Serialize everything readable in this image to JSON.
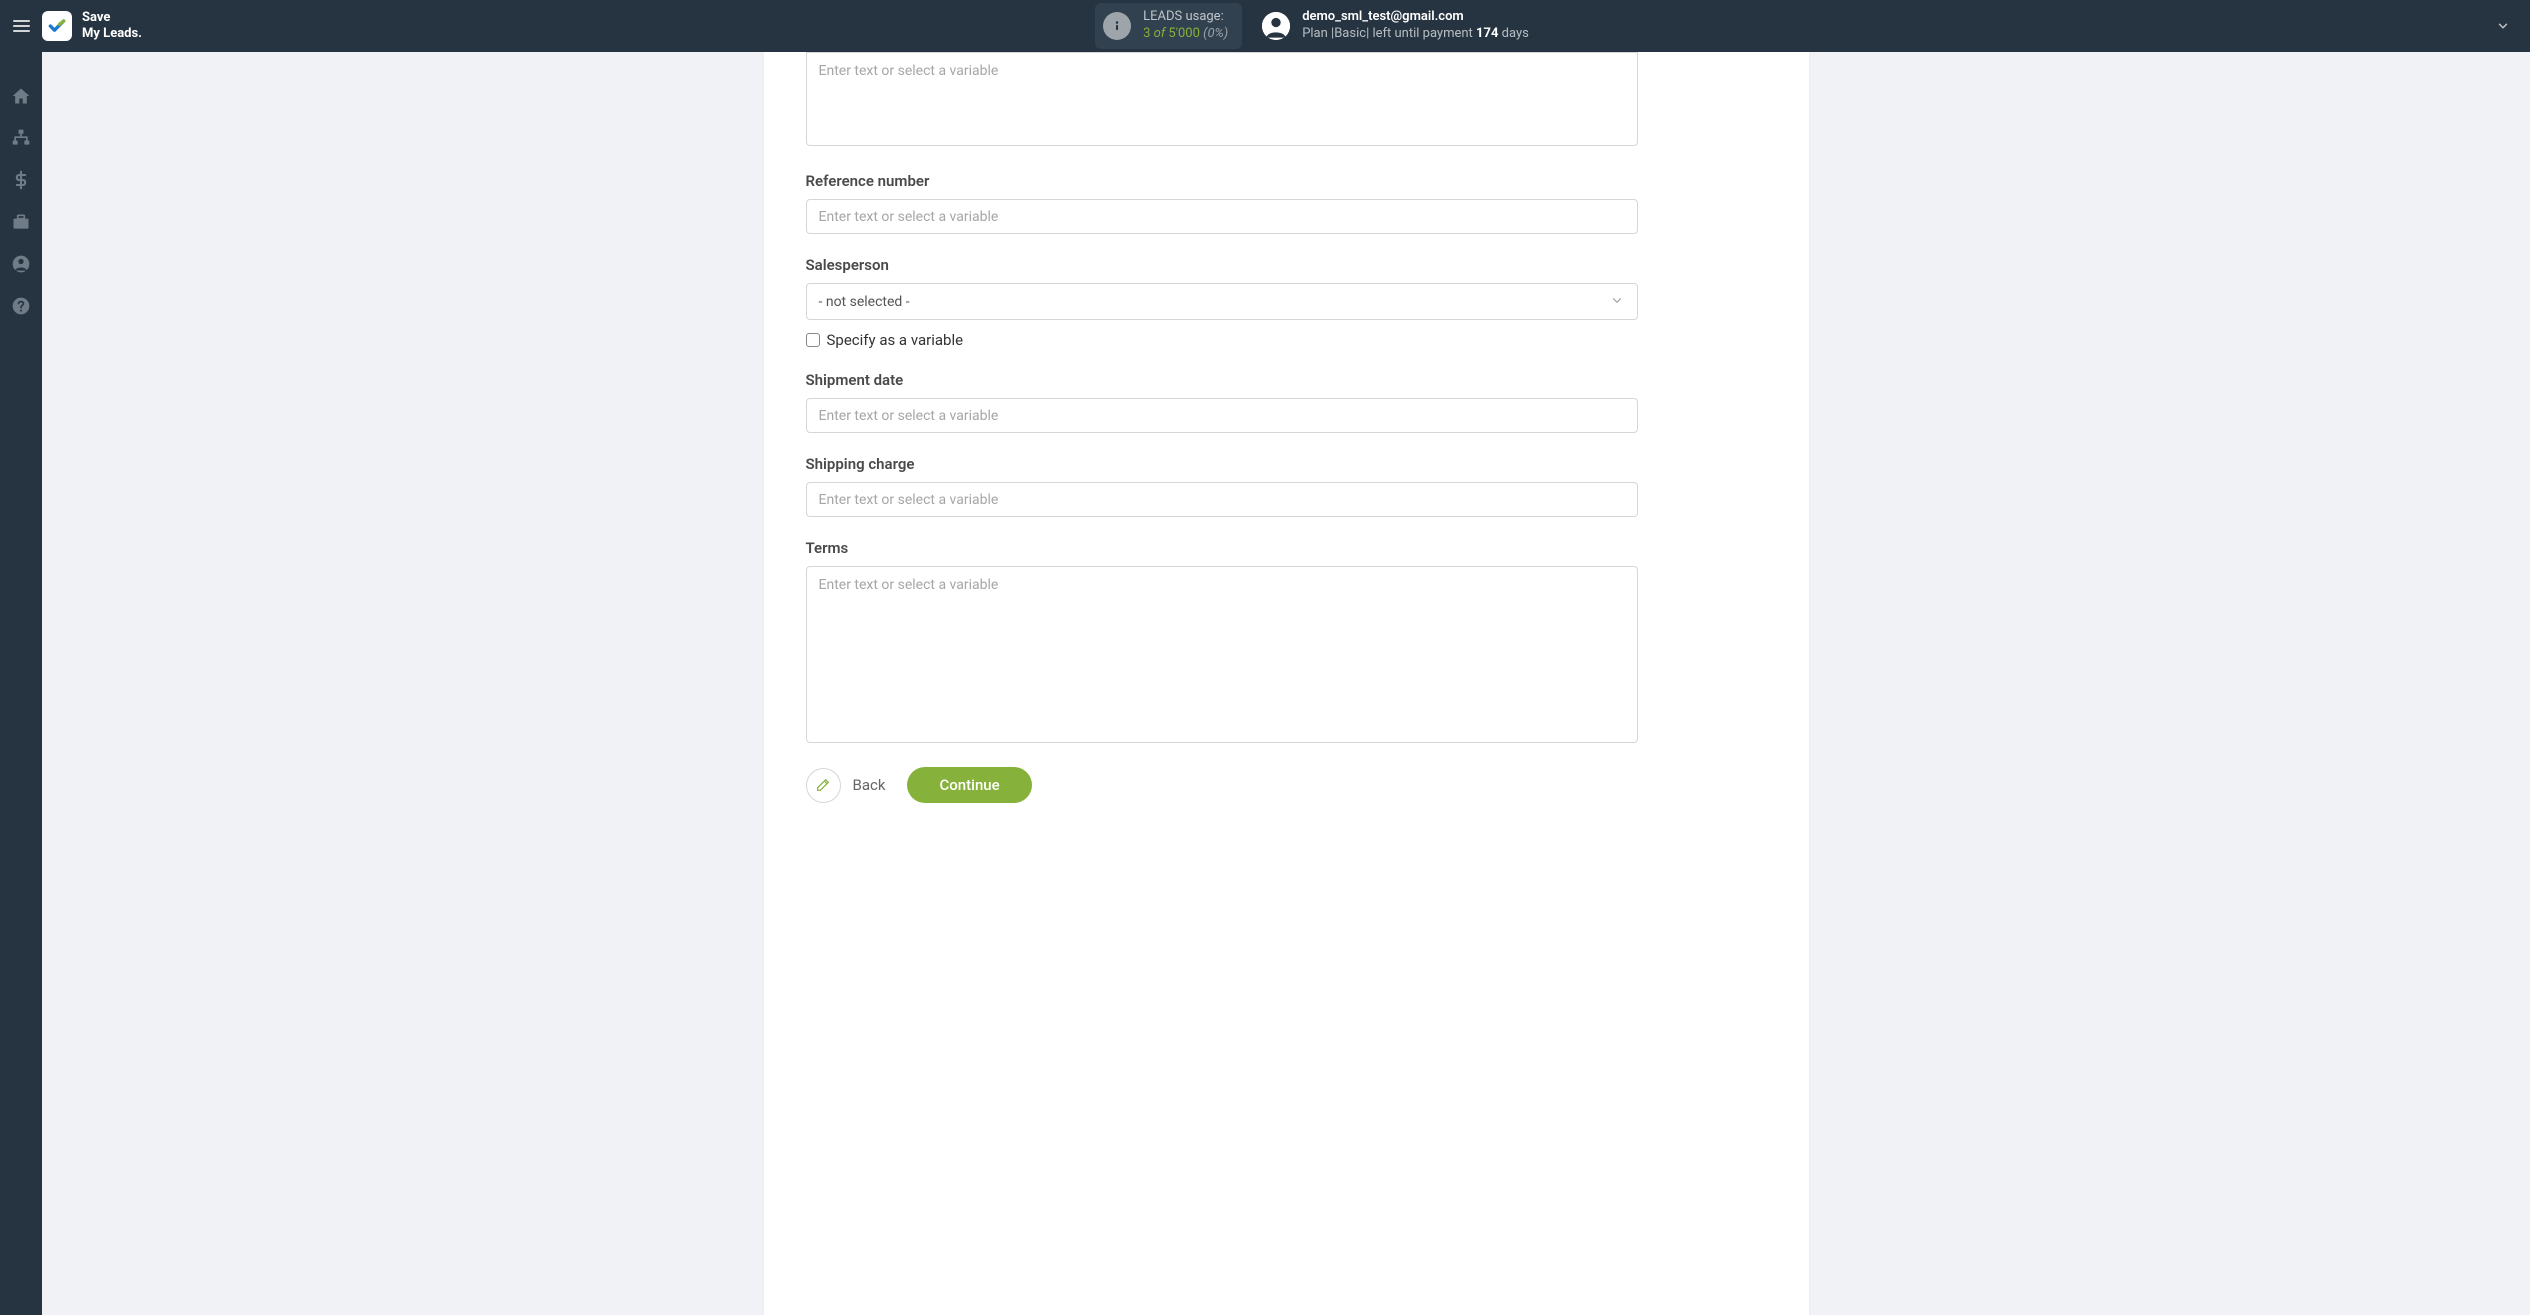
{
  "header": {
    "brand_line1": "Save",
    "brand_line2": "My Leads.",
    "usage": {
      "label": "LEADS usage:",
      "used": "3",
      "of_word": "of",
      "total": "5'000",
      "pct": "(0%)"
    },
    "user": {
      "email": "demo_sml_test@gmail.com",
      "plan_prefix": "Plan |",
      "plan_name": "Basic",
      "left_prefix": "| left until payment",
      "left_days": "174",
      "left_suffix": "days"
    }
  },
  "form": {
    "input_placeholder": "Enter text or select a variable",
    "fields": {
      "reference_number": {
        "label": "Reference number"
      },
      "salesperson": {
        "label": "Salesperson",
        "selected": "- not selected -",
        "specify_label": "Specify as a variable"
      },
      "shipment_date": {
        "label": "Shipment date"
      },
      "shipping_charge": {
        "label": "Shipping charge"
      },
      "terms": {
        "label": "Terms"
      }
    }
  },
  "buttons": {
    "back": "Back",
    "continue": "Continue"
  }
}
